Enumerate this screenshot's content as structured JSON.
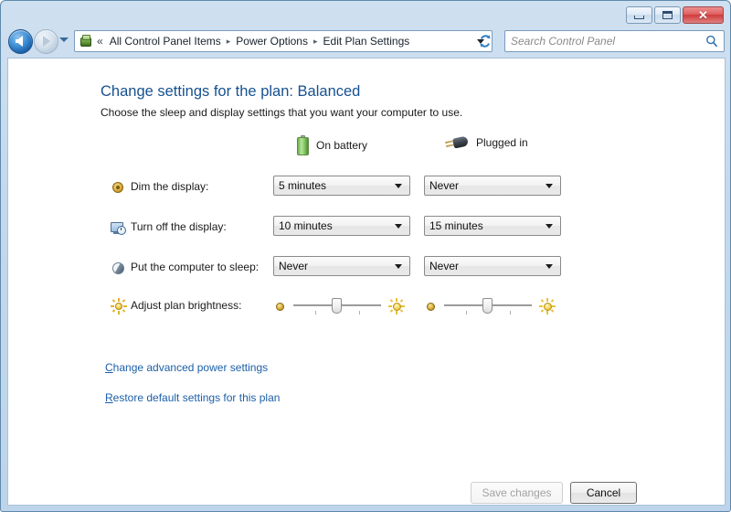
{
  "window": {
    "title": "",
    "buttons": {
      "minimize": "Minimize",
      "maximize": "Maximize",
      "close": "✕"
    }
  },
  "navbar": {
    "back": "Back",
    "forward": "Forward",
    "history_dropdown": "Recent pages",
    "breadcrumb": {
      "overflow": "«",
      "items": [
        {
          "label": "All Control Panel Items"
        },
        {
          "label": "Power Options"
        },
        {
          "label": "Edit Plan Settings"
        }
      ],
      "separator": "▸"
    },
    "refresh": "Refresh",
    "search": {
      "value": "",
      "placeholder": "Search Control Panel"
    }
  },
  "page": {
    "title": "Change settings for the plan: Balanced",
    "subtitle": "Choose the sleep and display settings that you want your computer to use.",
    "plan_name": "Balanced"
  },
  "columns": [
    {
      "id": "on-battery",
      "label": "On battery",
      "icon": "battery-icon"
    },
    {
      "id": "plugged-in",
      "label": "Plugged in",
      "icon": "power-plug-icon"
    }
  ],
  "settings": [
    {
      "id": "dim-display",
      "label": "Dim the display:",
      "icon": "dim-display-icon",
      "type": "dropdown",
      "on_battery": "5 minutes",
      "plugged_in": "Never"
    },
    {
      "id": "turn-off-display",
      "label": "Turn off the display:",
      "icon": "monitor-clock-icon",
      "type": "dropdown",
      "on_battery": "10 minutes",
      "plugged_in": "15 minutes"
    },
    {
      "id": "sleep",
      "label": "Put the computer to sleep:",
      "icon": "sleep-icon",
      "type": "dropdown",
      "on_battery": "Never",
      "plugged_in": "Never"
    },
    {
      "id": "brightness",
      "label": "Adjust plan brightness:",
      "icon": "brightness-sun-icon",
      "type": "slider",
      "on_battery": "50",
      "plugged_in": "50"
    }
  ],
  "links": [
    {
      "id": "advanced",
      "accel": "C",
      "rest": "hange advanced power settings"
    },
    {
      "id": "restore",
      "accel": "R",
      "rest": "estore default settings for this plan"
    }
  ],
  "actions": {
    "save": "Save changes",
    "cancel": "Cancel"
  },
  "colors": {
    "link": "#1c5fa8",
    "heading": "#17518f",
    "frame": "#c4d8ec",
    "close_button": "#cf3b3b",
    "battery_green": "#6ead4c"
  }
}
